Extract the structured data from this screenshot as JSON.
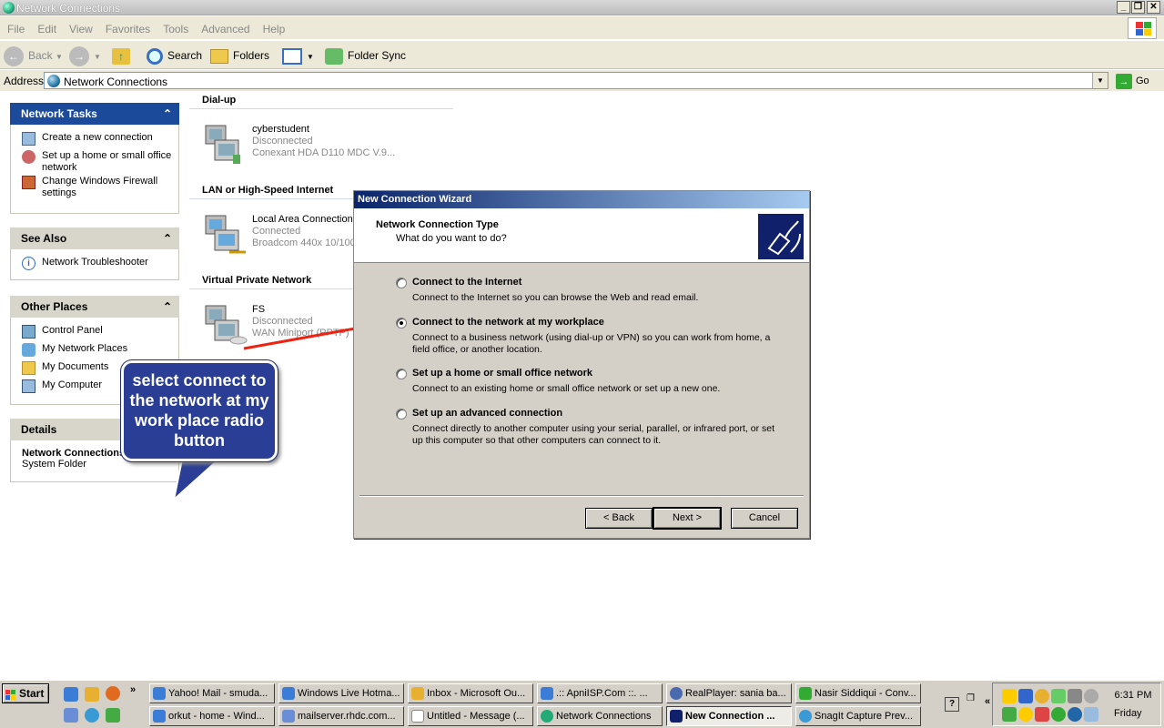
{
  "window": {
    "title": "Network Connections"
  },
  "menu": [
    "File",
    "Edit",
    "View",
    "Favorites",
    "Tools",
    "Advanced",
    "Help"
  ],
  "toolbar": {
    "back": "Back",
    "search": "Search",
    "folders": "Folders",
    "folder_sync": "Folder Sync"
  },
  "address": {
    "label": "Address",
    "value": "Network Connections",
    "go": "Go"
  },
  "sidebar": {
    "network_tasks": {
      "title": "Network Tasks",
      "items": [
        "Create a new connection",
        "Set up a home or small office network",
        "Change Windows Firewall settings"
      ]
    },
    "see_also": {
      "title": "See Also",
      "items": [
        "Network Troubleshooter"
      ]
    },
    "other_places": {
      "title": "Other Places",
      "items": [
        "Control Panel",
        "My Network Places",
        "My Documents",
        "My Computer"
      ]
    },
    "details": {
      "title": "Details",
      "name": "Network Connections",
      "type": "System Folder"
    }
  },
  "groups": {
    "dialup": {
      "title": "Dial-up",
      "conn": {
        "name": "cyberstudent",
        "status": "Disconnected",
        "device": "Conexant HDA D110 MDC V.9..."
      }
    },
    "lan": {
      "title": "LAN or High-Speed Internet",
      "conn": {
        "name": "Local Area Connection",
        "status": "Connected",
        "device": "Broadcom 440x 10/100"
      }
    },
    "vpn": {
      "title": "Virtual Private Network",
      "conn": {
        "name": "FS",
        "status": "Disconnected",
        "device": "WAN Miniport (PPTP)"
      }
    }
  },
  "callout": {
    "text": "select connect to the network at my work place radio button"
  },
  "wizard": {
    "title": "New Connection Wizard",
    "heading": "Network Connection Type",
    "subheading": "What do you want to do?",
    "options": [
      {
        "label": "Connect to the Internet",
        "desc": "Connect to the Internet so you can browse the Web and read email.",
        "selected": false
      },
      {
        "label": "Connect to the network at my workplace",
        "desc": "Connect to a business network (using dial-up or VPN) so you can work from home, a field office, or another location.",
        "selected": true
      },
      {
        "label": "Set up a home or small office network",
        "desc": "Connect to an existing home or small office network or set up a new one.",
        "selected": false
      },
      {
        "label": "Set up an advanced connection",
        "desc": "Connect directly to another computer using your serial, parallel, or infrared port, or set up this computer so that other computers can connect to it.",
        "selected": false
      }
    ],
    "back": "< Back",
    "next": "Next >",
    "cancel": "Cancel"
  },
  "taskbar": {
    "start": "Start",
    "tasks_row1": [
      "Yahoo! Mail - smuda...",
      "Windows Live Hotma...",
      "Inbox - Microsoft Ou...",
      ".:: ApniISP.Com ::. ...",
      "RealPlayer: sania ba...",
      "Nasir Siddiqui - Conv..."
    ],
    "tasks_row2": [
      "orkut - home - Wind...",
      "mailserver.rhdc.com...",
      "Untitled - Message (...",
      "Network Connections",
      "New Connection ...",
      "SnagIt Capture Prev..."
    ],
    "time": "6:31 PM",
    "day": "Friday"
  }
}
